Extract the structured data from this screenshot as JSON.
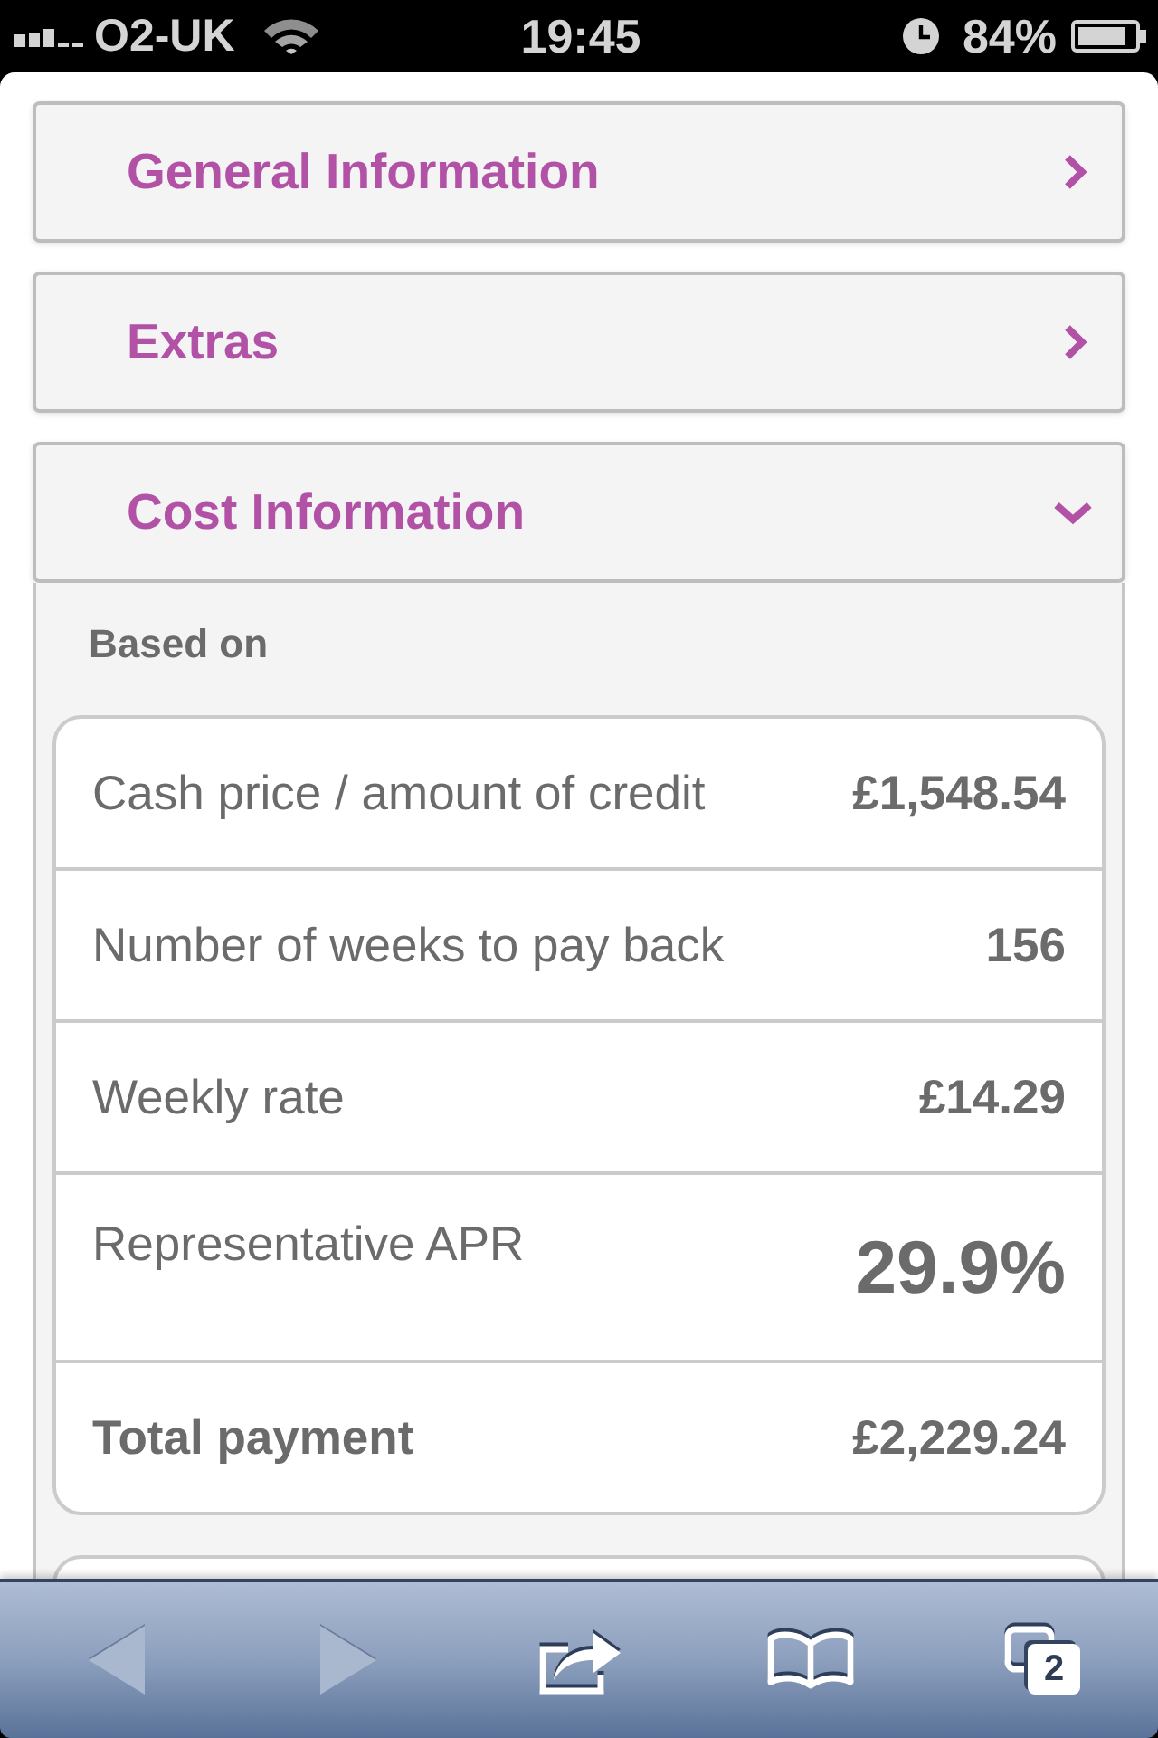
{
  "status_bar": {
    "carrier": "O2-UK",
    "time": "19:45",
    "battery": "84%"
  },
  "sections": [
    {
      "title": "General Information",
      "expanded": false
    },
    {
      "title": "Extras",
      "expanded": false
    },
    {
      "title": "Cost Information",
      "expanded": true,
      "content": {
        "heading": "Based on",
        "rows": [
          {
            "kind": "normal",
            "label": "Cash price / amount of credit",
            "value": "£1,548.54"
          },
          {
            "kind": "normal",
            "label": "Number of weeks to pay back",
            "value": "156"
          },
          {
            "kind": "normal",
            "label": "Weekly rate",
            "value": "£14.29"
          },
          {
            "kind": "apr",
            "label": "Representative APR",
            "value": "29.9%"
          },
          {
            "kind": "total",
            "label": "Total payment",
            "value": "£2,229.24"
          }
        ]
      }
    }
  ],
  "toolbar": [
    {
      "kind": "back",
      "disabled": true
    },
    {
      "kind": "forward",
      "disabled": true
    },
    {
      "kind": "share",
      "disabled": false
    },
    {
      "kind": "bookmarks",
      "disabled": false
    },
    {
      "kind": "tabs",
      "disabled": false,
      "count": "2"
    }
  ]
}
